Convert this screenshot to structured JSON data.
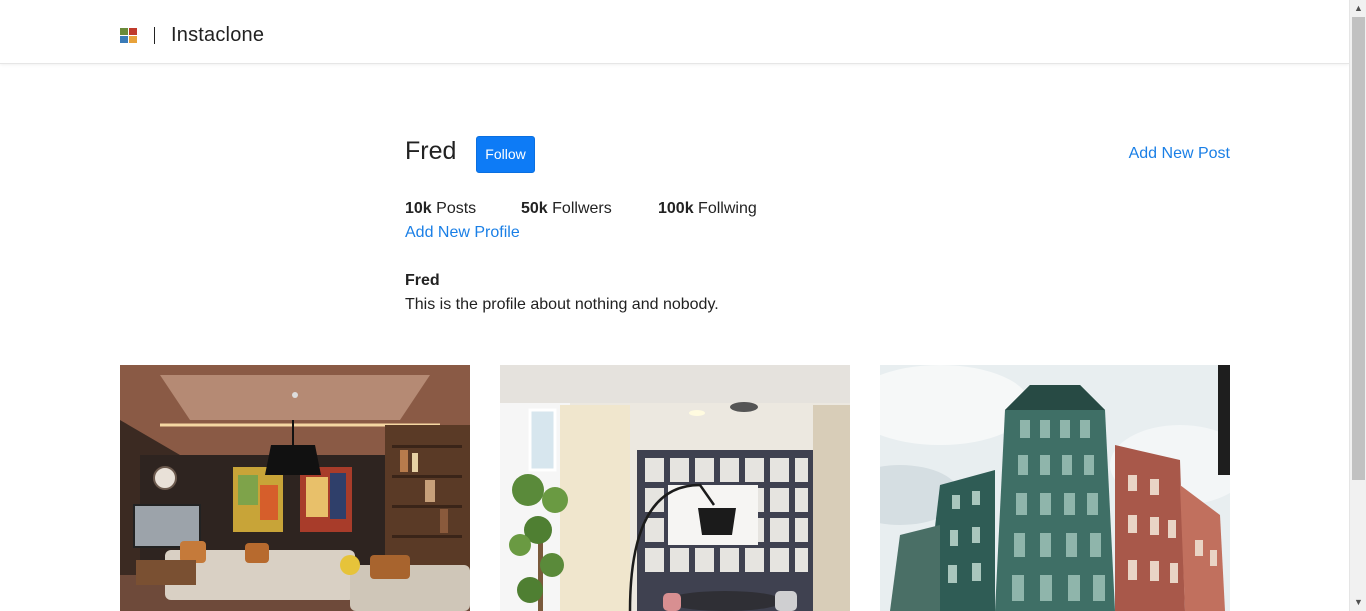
{
  "navbar": {
    "brand": "Instaclone",
    "logo_icon": "instaclone-logo-icon"
  },
  "profile": {
    "username": "Fred",
    "follow_label": "Follow",
    "add_post_label": "Add New Post",
    "add_profile_label": "Add New Profile",
    "stats": {
      "posts_count": "10k",
      "posts_label": "Posts",
      "followers_count": "50k",
      "followers_label": "Follwers",
      "following_count": "100k",
      "following_label": "Follwing"
    },
    "bio": {
      "name": "Fred",
      "text": "This is the profile about nothing and nobody."
    }
  },
  "posts": [
    {
      "alt": "Living room interior with paintings and bookshelves"
    },
    {
      "alt": "Bright room with shelving, lamp and plant"
    },
    {
      "alt": "Green and red apartment building facade"
    }
  ],
  "colors": {
    "link": "#1a7fe6",
    "button": "#0d7bf6"
  }
}
